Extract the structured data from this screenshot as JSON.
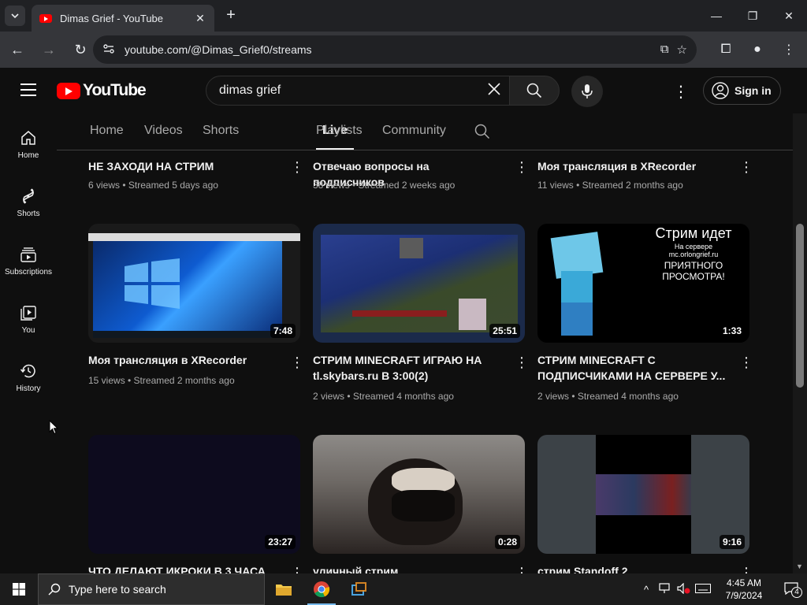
{
  "browser": {
    "tab_title": "Dimas Grief - YouTube",
    "url": "youtube.com/@Dimas_Grief0/streams"
  },
  "header": {
    "logo_text": "YouTube",
    "search_value": "dimas grief",
    "signin_label": "Sign in"
  },
  "sidebar": {
    "items": [
      {
        "label": "Home",
        "icon": "home-icon"
      },
      {
        "label": "Shorts",
        "icon": "shorts-icon"
      },
      {
        "label": "Subscriptions",
        "icon": "subscriptions-icon"
      },
      {
        "label": "You",
        "icon": "you-icon"
      },
      {
        "label": "History",
        "icon": "history-icon"
      }
    ]
  },
  "channel_tabs": [
    "Home",
    "Videos",
    "Shorts",
    "Live",
    "Playlists",
    "Community"
  ],
  "active_tab": "Live",
  "videos": [
    {
      "title": "НЕ ЗАХОДИ НА СТРИМ",
      "meta": "6 views • Streamed 5 days ago",
      "duration": ""
    },
    {
      "title": "Отвечаю вопросы на подписчиков",
      "meta": "38 views • Streamed 2 weeks ago",
      "duration": ""
    },
    {
      "title": "Моя трансляция в XRecorder",
      "meta": "11 views • Streamed 2 months ago",
      "duration": ""
    },
    {
      "title": "Моя трансляция в XRecorder",
      "meta": "15 views • Streamed 2 months ago",
      "duration": "7:48"
    },
    {
      "title": "СТРИМ MINECRAFT ИГРАЮ НА tl.skybars.ru В 3:00(2)",
      "meta": "2 views • Streamed 4 months ago",
      "duration": "25:51"
    },
    {
      "title": "СТРИМ MINECRAFT С ПОДПИСЧИКАМИ НА СЕРВЕРЕ У...",
      "meta": "2 views • Streamed 4 months ago",
      "duration": "1:33"
    },
    {
      "title": "ЧТО ДЕЛАЮТ ИКРОКИ В 3 ЧАСА",
      "meta": "",
      "duration": "23:27"
    },
    {
      "title": "уличный стрим",
      "meta": "",
      "duration": "0:28"
    },
    {
      "title": "стрим Standoff 2",
      "meta": "",
      "duration": "9:16"
    }
  ],
  "thumb_texts": {
    "stream_title": "Стрим идет",
    "stream_line1": "На сервере",
    "stream_line2": "mc.orlongrief.ru",
    "stream_line3": "ПРИЯТНОГО",
    "stream_line4": "ПРОСМОТРА!"
  },
  "taskbar": {
    "search_placeholder": "Type here to search",
    "time": "4:45 AM",
    "date": "7/9/2024",
    "notification_count": "4"
  }
}
